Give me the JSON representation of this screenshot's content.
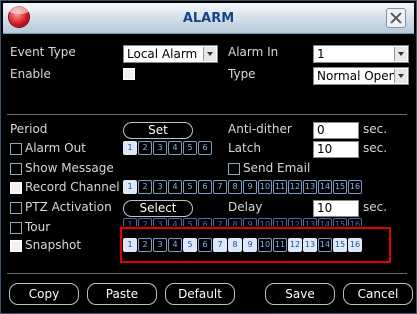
{
  "window": {
    "title": "ALARM"
  },
  "event_type": {
    "label": "Event Type",
    "value": "Local Alarm"
  },
  "alarm_in": {
    "label": "Alarm In",
    "value": "1"
  },
  "enable": {
    "label": "Enable",
    "checked": false
  },
  "type": {
    "label": "Type",
    "value": "Normal Open"
  },
  "period": {
    "label": "Period",
    "button": "Set"
  },
  "anti_dither": {
    "label": "Anti-dither",
    "value": "0",
    "unit": "sec."
  },
  "alarm_out": {
    "label": "Alarm Out",
    "checked": false,
    "channels": [
      "1",
      "2",
      "3",
      "4",
      "5",
      "6"
    ],
    "on": [
      1
    ]
  },
  "latch": {
    "label": "Latch",
    "value": "10",
    "unit": "sec."
  },
  "show_message": {
    "label": "Show Message",
    "checked": false
  },
  "send_email": {
    "label": "Send Email",
    "checked": false
  },
  "record_channel": {
    "label": "Record Channel",
    "checked": true,
    "channels": [
      "1",
      "2",
      "3",
      "4",
      "5",
      "6",
      "7",
      "8",
      "9",
      "10",
      "11",
      "12",
      "13",
      "14",
      "15",
      "16"
    ],
    "on": [
      1
    ]
  },
  "ptz_activation": {
    "label": "PTZ Activation",
    "checked": false,
    "button": "Select"
  },
  "delay": {
    "label": "Delay",
    "value": "10",
    "unit": "sec."
  },
  "tour": {
    "label": "Tour",
    "checked": false,
    "channels": [
      "1",
      "2",
      "3",
      "4",
      "5",
      "6",
      "7",
      "8",
      "9",
      "10",
      "11",
      "12",
      "13",
      "14",
      "15",
      "16"
    ]
  },
  "snapshot": {
    "label": "Snapshot",
    "checked": true,
    "channels": [
      "1",
      "2",
      "3",
      "4",
      "5",
      "6",
      "7",
      "8",
      "9",
      "10",
      "11",
      "12",
      "13",
      "14",
      "15",
      "16"
    ],
    "on": [
      1,
      5,
      7,
      8,
      9,
      12,
      13,
      15,
      16
    ]
  },
  "buttons": {
    "copy": "Copy",
    "paste": "Paste",
    "default": "Default",
    "save": "Save",
    "cancel": "Cancel"
  },
  "colors": {
    "highlight_box": "#e00000",
    "title_text": "#18458a"
  }
}
